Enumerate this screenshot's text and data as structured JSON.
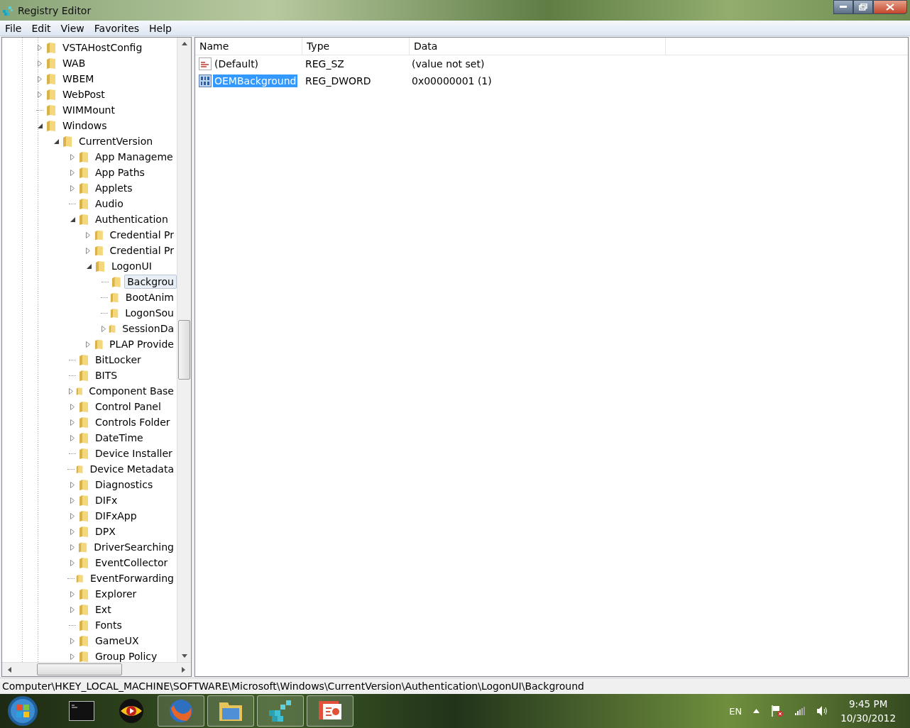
{
  "window": {
    "title": "Registry Editor"
  },
  "menu": [
    "File",
    "Edit",
    "View",
    "Favorites",
    "Help"
  ],
  "tree": [
    {
      "label": "VSTAHostConfig",
      "kind": "branch",
      "expanded": false,
      "selected": false
    },
    {
      "label": "WAB",
      "kind": "branch",
      "expanded": false,
      "selected": false
    },
    {
      "label": "WBEM",
      "kind": "branch",
      "expanded": false,
      "selected": false
    },
    {
      "label": "WebPost",
      "kind": "branch",
      "expanded": false,
      "selected": false
    },
    {
      "label": "WIMMount",
      "kind": "leaf",
      "selected": false
    },
    {
      "label": "Windows",
      "kind": "branch",
      "expanded": true,
      "selected": false,
      "children": [
        {
          "label": "CurrentVersion",
          "kind": "branch",
          "expanded": true,
          "selected": false,
          "children": [
            {
              "label": "App Manageme",
              "kind": "branch",
              "expanded": false,
              "selected": false
            },
            {
              "label": "App Paths",
              "kind": "branch",
              "expanded": false,
              "selected": false
            },
            {
              "label": "Applets",
              "kind": "branch",
              "expanded": false,
              "selected": false
            },
            {
              "label": "Audio",
              "kind": "leaf",
              "selected": false
            },
            {
              "label": "Authentication",
              "kind": "branch",
              "expanded": true,
              "selected": false,
              "children": [
                {
                  "label": "Credential Pr",
                  "kind": "branch",
                  "expanded": false,
                  "selected": false
                },
                {
                  "label": "Credential Pr",
                  "kind": "branch",
                  "expanded": false,
                  "selected": false
                },
                {
                  "label": "LogonUI",
                  "kind": "branch",
                  "expanded": true,
                  "selected": false,
                  "children": [
                    {
                      "label": "Backgrou",
                      "kind": "leaf",
                      "selected": true
                    },
                    {
                      "label": "BootAnim",
                      "kind": "leaf",
                      "selected": false
                    },
                    {
                      "label": "LogonSou",
                      "kind": "leaf",
                      "selected": false
                    },
                    {
                      "label": "SessionDa",
                      "kind": "branch",
                      "expanded": false,
                      "selected": false
                    }
                  ]
                },
                {
                  "label": "PLAP Provide",
                  "kind": "branch",
                  "expanded": false,
                  "selected": false
                }
              ]
            },
            {
              "label": "BitLocker",
              "kind": "leaf",
              "selected": false
            },
            {
              "label": "BITS",
              "kind": "leaf",
              "selected": false
            },
            {
              "label": "Component Base",
              "kind": "branch",
              "expanded": false,
              "selected": false
            },
            {
              "label": "Control Panel",
              "kind": "branch",
              "expanded": false,
              "selected": false
            },
            {
              "label": "Controls Folder",
              "kind": "branch",
              "expanded": false,
              "selected": false
            },
            {
              "label": "DateTime",
              "kind": "branch",
              "expanded": false,
              "selected": false
            },
            {
              "label": "Device Installer",
              "kind": "leaf",
              "selected": false
            },
            {
              "label": "Device Metadata",
              "kind": "leaf",
              "selected": false
            },
            {
              "label": "Diagnostics",
              "kind": "branch",
              "expanded": false,
              "selected": false
            },
            {
              "label": "DIFx",
              "kind": "branch",
              "expanded": false,
              "selected": false
            },
            {
              "label": "DIFxApp",
              "kind": "branch",
              "expanded": false,
              "selected": false
            },
            {
              "label": "DPX",
              "kind": "branch",
              "expanded": false,
              "selected": false
            },
            {
              "label": "DriverSearching",
              "kind": "branch",
              "expanded": false,
              "selected": false
            },
            {
              "label": "EventCollector",
              "kind": "branch",
              "expanded": false,
              "selected": false
            },
            {
              "label": "EventForwarding",
              "kind": "leaf",
              "selected": false
            },
            {
              "label": "Explorer",
              "kind": "branch",
              "expanded": false,
              "selected": false
            },
            {
              "label": "Ext",
              "kind": "branch",
              "expanded": false,
              "selected": false
            },
            {
              "label": "Fonts",
              "kind": "leaf",
              "selected": false
            },
            {
              "label": "GameUX",
              "kind": "branch",
              "expanded": false,
              "selected": false
            },
            {
              "label": "Group Policy",
              "kind": "branch",
              "expanded": false,
              "selected": false
            }
          ]
        }
      ]
    }
  ],
  "table": {
    "columns": [
      "Name",
      "Type",
      "Data"
    ],
    "rows": [
      {
        "kind": "string",
        "name": "(Default)",
        "type": "REG_SZ",
        "data": "(value not set)",
        "selected": false
      },
      {
        "kind": "binary",
        "name": "OEMBackground",
        "type": "REG_DWORD",
        "data": "0x00000001 (1)",
        "selected": true
      }
    ]
  },
  "status_bar": "Computer\\HKEY_LOCAL_MACHINE\\SOFTWARE\\Microsoft\\Windows\\CurrentVersion\\Authentication\\LogonUI\\Background",
  "taskbar": {
    "apps": [
      {
        "kind": "terminal",
        "running": false
      },
      {
        "kind": "player",
        "running": false
      },
      {
        "kind": "browser",
        "running": true
      },
      {
        "kind": "folder",
        "running": true
      },
      {
        "kind": "registry",
        "running": true
      },
      {
        "kind": "presentation",
        "running": true
      }
    ],
    "language": "EN",
    "time": "9:45 PM",
    "date": "10/30/2012"
  }
}
